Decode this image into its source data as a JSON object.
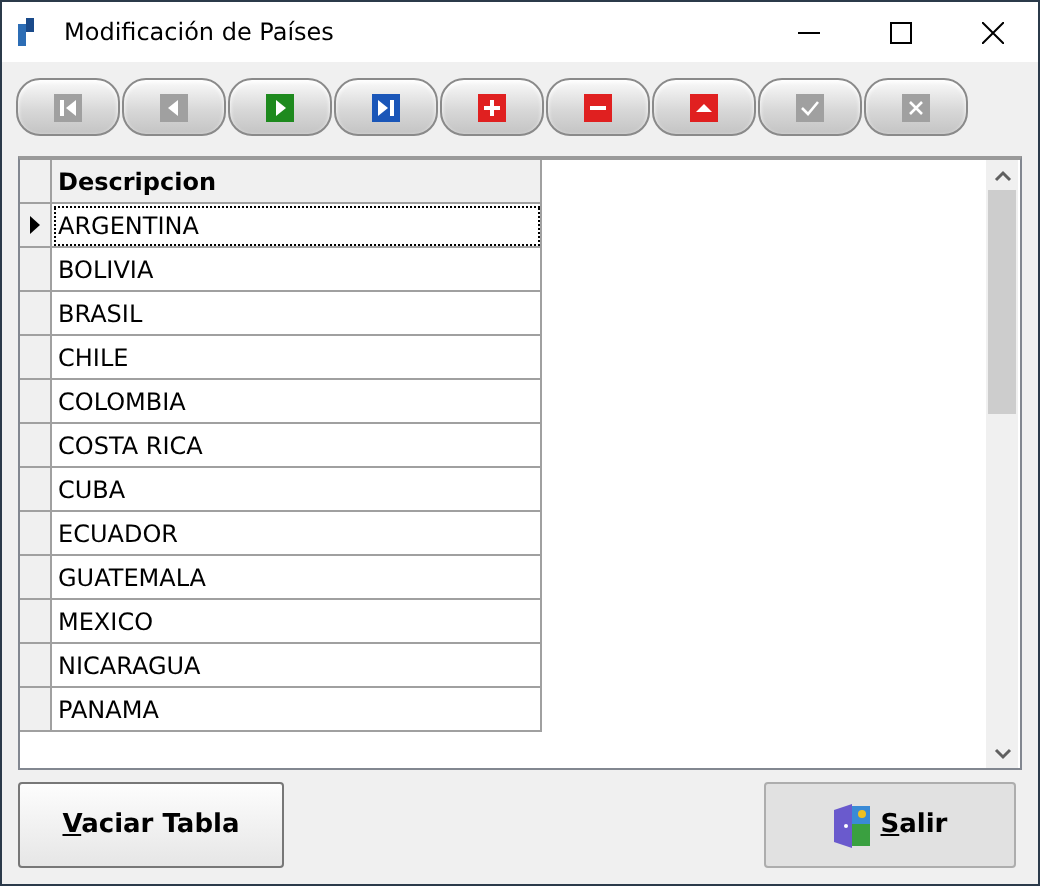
{
  "window": {
    "title": "Modificación de Países"
  },
  "toolbar": [
    {
      "kind": "first",
      "disabled": true
    },
    {
      "kind": "prior",
      "disabled": true
    },
    {
      "kind": "next",
      "disabled": false
    },
    {
      "kind": "last",
      "disabled": false
    },
    {
      "kind": "insert",
      "disabled": false
    },
    {
      "kind": "delete",
      "disabled": false
    },
    {
      "kind": "edit",
      "disabled": false
    },
    {
      "kind": "post",
      "disabled": true
    },
    {
      "kind": "cancel",
      "disabled": true
    }
  ],
  "table": {
    "columns": [
      "Descripcion"
    ],
    "rows": [
      {
        "cells": [
          "ARGENTINA"
        ],
        "selected": true
      },
      {
        "cells": [
          "BOLIVIA"
        ],
        "selected": false
      },
      {
        "cells": [
          "BRASIL"
        ],
        "selected": false
      },
      {
        "cells": [
          "CHILE"
        ],
        "selected": false
      },
      {
        "cells": [
          "COLOMBIA"
        ],
        "selected": false
      },
      {
        "cells": [
          "COSTA RICA"
        ],
        "selected": false
      },
      {
        "cells": [
          "CUBA"
        ],
        "selected": false
      },
      {
        "cells": [
          "ECUADOR"
        ],
        "selected": false
      },
      {
        "cells": [
          "GUATEMALA"
        ],
        "selected": false
      },
      {
        "cells": [
          "MEXICO"
        ],
        "selected": false
      },
      {
        "cells": [
          "NICARAGUA"
        ],
        "selected": false
      },
      {
        "cells": [
          "PANAMA"
        ],
        "selected": false
      }
    ]
  },
  "buttons": [
    {
      "label": "Vaciar Tabla",
      "kind": "plain",
      "underline_first": true
    },
    {
      "label": "Salir",
      "kind": "exit",
      "underline_first": true
    }
  ]
}
